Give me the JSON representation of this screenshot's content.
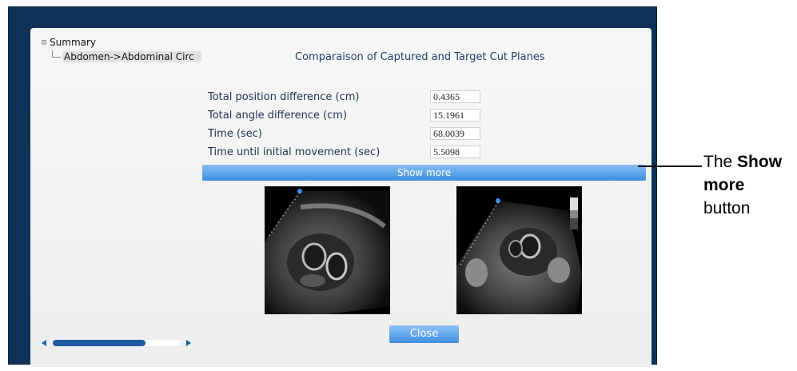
{
  "tree": {
    "root_label": "Summary",
    "child_label": "Abdomen->Abdominal Circ"
  },
  "heading": "Comparaison of Captured and Target Cut Planes",
  "metrics": [
    {
      "label": "Total position difference (cm)",
      "value": "0.4365"
    },
    {
      "label": "Total angle difference (cm)",
      "value": "15.1961"
    },
    {
      "label": "Time (sec)",
      "value": "68.0039"
    },
    {
      "label": "Time until initial movement (sec)",
      "value": "5.5098"
    }
  ],
  "show_more_label": "Show more",
  "close_label": "Close",
  "callout": {
    "prefix": "The ",
    "bold": "Show more",
    "suffix": " button"
  },
  "colors": {
    "frame": "#0f3358",
    "button": "#3f8ee0",
    "heading": "#1f3d6e"
  },
  "images": [
    {
      "name": "captured-plane-image"
    },
    {
      "name": "target-plane-image"
    }
  ]
}
